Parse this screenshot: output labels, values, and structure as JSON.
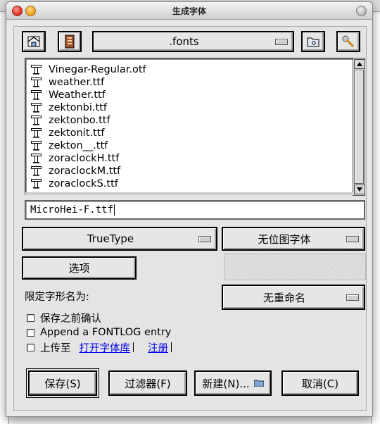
{
  "window": {
    "title": "生成字体"
  },
  "toolbar": {
    "home_icon": "home-icon",
    "doc_icon": "document-icon",
    "directory": ".fonts",
    "folder_icon": "folder-icon",
    "tools_icon": "tools-icon"
  },
  "file_list": {
    "items": [
      "Vinegar-Regular.otf",
      "weather.ttf",
      "Weather.ttf",
      "zektonbi.ttf",
      "zektonbo.ttf",
      "zektonit.ttf",
      "zekton__.ttf",
      "zoraclockH.ttf",
      "zoraclockM.ttf",
      "zoraclockS.ttf"
    ]
  },
  "filename": {
    "value": "MicroHei-F.ttf"
  },
  "options": {
    "outline_format": "TrueType",
    "bitmap_format": "无位图字体",
    "options_button": "选项",
    "restrict_label": "限定字形名为:",
    "rename_select": "无重命名"
  },
  "checkboxes": {
    "confirm_before_save": "保存之前确认",
    "append_fontlog": "Append a FONTLOG entry",
    "upload_to": "上传至",
    "open_font_library_link": "打开字体库",
    "register_link": "注册"
  },
  "buttons": {
    "save": "保存(S)",
    "filter": "过滤器(F)",
    "new": "新建(N)...",
    "cancel": "取消(C)"
  },
  "colors": {
    "link": "#0000ee",
    "close": "#e0342a",
    "minimize": "#f5a623"
  }
}
